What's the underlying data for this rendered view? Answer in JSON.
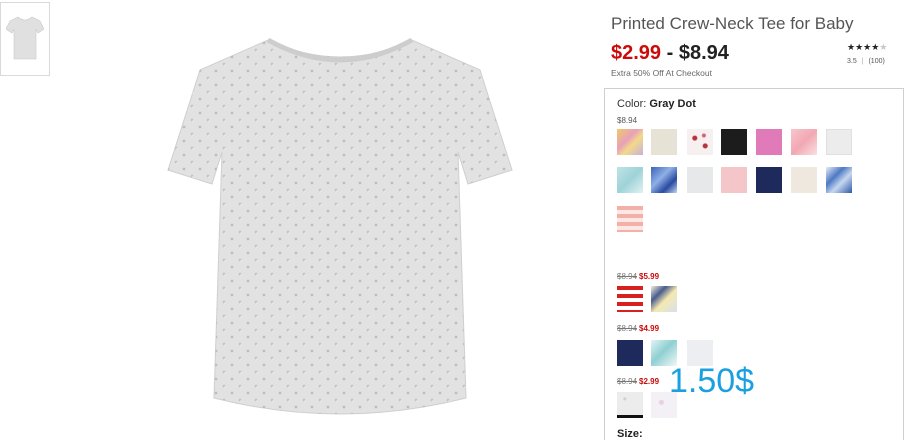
{
  "product": {
    "title": "Printed Crew-Neck Tee for Baby",
    "price_low": "$2.99",
    "price_sep": " - ",
    "price_high": "$8.94",
    "promo": "Extra 50% Off At Checkout",
    "rating": {
      "stars": 3.5,
      "value": "3.5",
      "separator": "|",
      "count": "(100)"
    }
  },
  "color": {
    "label": "Color:",
    "selected": "Gray Dot",
    "price": "$8.94",
    "swatches_row1": [
      "floral-yellow",
      "beige",
      "white-red-dots",
      "black",
      "pink",
      "pink-floral",
      "light-gray"
    ],
    "swatches_row2": [
      "aqua-print",
      "blue-abstract",
      "pale-gray",
      "light-pink",
      "navy",
      "cream",
      "blue-floral"
    ],
    "swatches_row3": [
      "coral-stripe"
    ]
  },
  "groups": [
    {
      "old_price": "$8.94",
      "new_price": "$5.99",
      "swatches": [
        "red-stripe",
        "cartoon-print"
      ]
    },
    {
      "old_price": "$8.94",
      "new_price": "$4.99",
      "swatches": [
        "navy",
        "aqua-print",
        "off-white"
      ]
    },
    {
      "old_price": "$8.94",
      "new_price": "$2.99",
      "swatches": [
        "gray-dot",
        "pale-print"
      ]
    }
  ],
  "overlay_text": "1.50$",
  "size_label": "Size:",
  "colors": {
    "sale_red": "#cc0a0a",
    "overlay_blue": "#1aa0e0",
    "shirt_gray": "#e2e2e2"
  }
}
